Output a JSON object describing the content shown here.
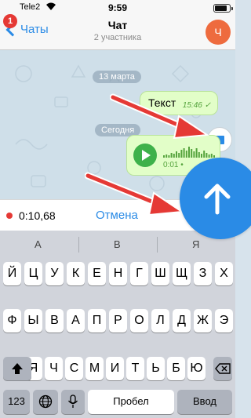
{
  "status_bar": {
    "carrier": "Tele2",
    "time": "9:59",
    "battery_percent": 85
  },
  "nav": {
    "back_label": "Чаты",
    "badge": "1",
    "title": "Чат",
    "subtitle": "2 участника",
    "avatar_letter": "Ч",
    "avatar_color": "#ee6b3e"
  },
  "chat": {
    "date1": "13 марта",
    "date2": "Сегодня",
    "text_message": {
      "text": "Текст",
      "time": "15:46",
      "check": "✓"
    },
    "voice_message": {
      "duration": "0:01",
      "dot": "•"
    }
  },
  "recording": {
    "elapsed": "0:10,68",
    "cancel_label": "Отмена"
  },
  "keyboard": {
    "suggestions": [
      "А",
      "В",
      "Я"
    ],
    "row1": [
      "Й",
      "Ц",
      "У",
      "К",
      "Е",
      "Н",
      "Г",
      "Ш",
      "Щ",
      "З",
      "Х"
    ],
    "row2": [
      "Ф",
      "Ы",
      "В",
      "А",
      "П",
      "Р",
      "О",
      "Л",
      "Д",
      "Ж",
      "Э"
    ],
    "row3": [
      "Я",
      "Ч",
      "С",
      "М",
      "И",
      "Т",
      "Ь",
      "Б",
      "Ю"
    ],
    "num_label": "123",
    "space_label": "Пробел",
    "enter_label": "Ввод"
  },
  "colors": {
    "accent": "#2a8be6",
    "bubble": "#e2fec8",
    "arrow": "#e53935",
    "record_dot": "#e53935"
  }
}
